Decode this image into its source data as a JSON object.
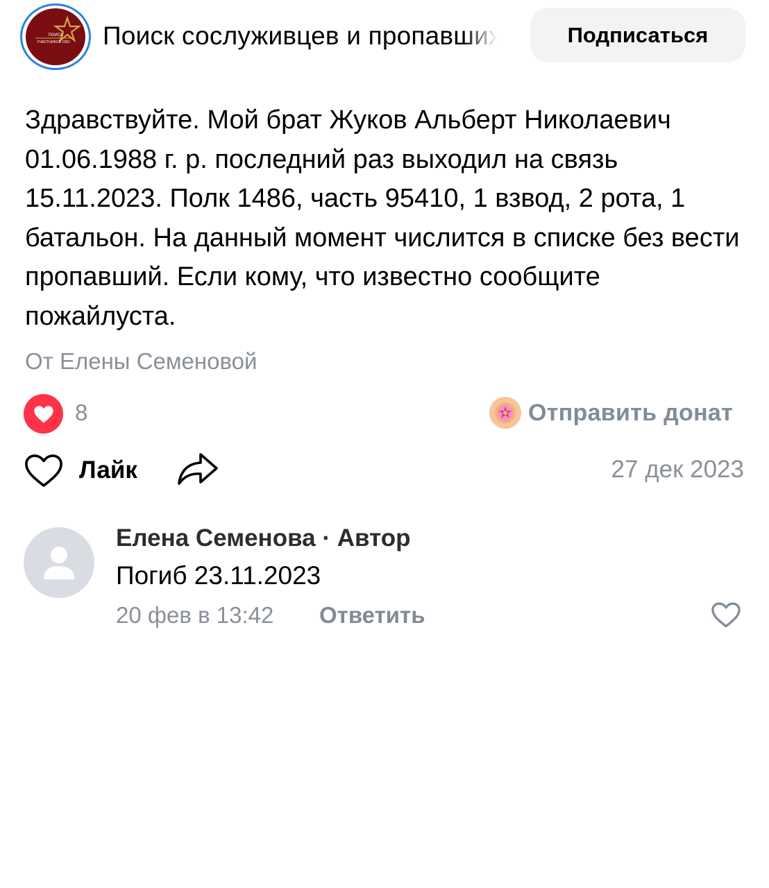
{
  "header": {
    "group_title": "Поиск сослуживцев и пропавших",
    "subscribe_label": "Подписаться",
    "logo_text_line1": "ПОИСК",
    "logo_text_line2": "УЧАСТНИКОВ СВО",
    "colors": {
      "avatar_ring": "#2d81e0",
      "logo_background": "#7a0d12",
      "logo_gold": "#d6a647",
      "subscribe_background": "#f2f3f5"
    }
  },
  "post": {
    "text": "Здравствуйте. Мой брат Жуков Альберт Николаевич 01.06.1988 г. р. последний раз выходил на связь 15.11.2023. Полк 1486, часть 95410, 1 взвод, 2 рота, 1 батальон. На данный момент числится в списке без вести пропавший. Если кому, что известно сообщите пожайлуста.",
    "author": "От Елены Семеновой",
    "reactions": {
      "icon": "heart-icon",
      "count": "8",
      "color": "#ff3347"
    },
    "donate": {
      "icon": "donut-icon",
      "label": "Отправить донат"
    },
    "actions": {
      "like_label": "Лайк",
      "like_icon": "heart-outline-icon",
      "share_icon": "share-icon"
    },
    "date": "27 дек 2023"
  },
  "comment": {
    "author": "Елена Семенова",
    "separator": "·",
    "role": "Автор",
    "text": "Погиб 23.11.2023",
    "time": "20 фев в 13:42",
    "reply_label": "Ответить",
    "avatar_icon": "user-placeholder-icon",
    "like_icon": "heart-outline-icon"
  }
}
